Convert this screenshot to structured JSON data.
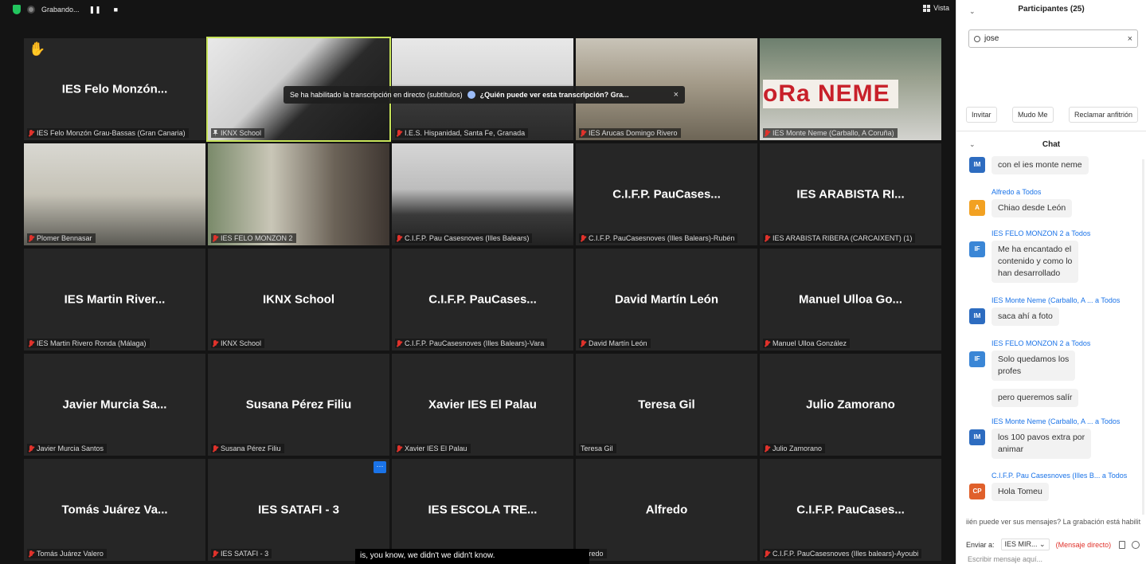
{
  "topbar": {
    "recording_label": "Grabando...",
    "pause_icon_text": "❚❚",
    "stop_icon_text": "■",
    "view_label": "Vista"
  },
  "transcription_banner": {
    "text": "Se ha habilitado la transcripción en directo (subtítulos)",
    "question": "¿Quién puede ver esta transcripción? Gra...",
    "close": "×"
  },
  "caption": "is, you know, we didn't we didn't know.",
  "more_button": "···",
  "tiles": [
    {
      "big": "IES Felo Monzón...",
      "label": "IES Felo Monzón Grau-Bassas (Gran Canaria)",
      "hand": true
    },
    {
      "big": "",
      "label": "IKNX School",
      "photo": "iknx-photo",
      "active": true,
      "pinned": true
    },
    {
      "big": "",
      "label": "I.E.S. Hispanidad, Santa Fe, Granada",
      "photo": "classroom-photo"
    },
    {
      "big": "",
      "label": "IES Arucas Domingo Rivero",
      "photo": "hall-photo"
    },
    {
      "big": "",
      "label": "IES Monte Neme (Carballo, A Coruña)",
      "photo": "neme-photo",
      "banner": "oRa NEME"
    },
    {
      "big": "",
      "label": "Plomer Bennasar",
      "photo": "lab-photo"
    },
    {
      "big": "",
      "label": "IES FELO MONZON 2",
      "photo": "couple-photo"
    },
    {
      "big": "",
      "label": "C.I.F.P. Pau Casesnoves (Illes Balears)",
      "photo": "headset-photo"
    },
    {
      "big": "C.I.F.P. PauCases...",
      "label": "C.I.F.P. PauCasesnoves (Illes Balears)-Rubén"
    },
    {
      "big": "IES ARABISTA RI...",
      "label": "IES ARABISTA RIBERA (CARCAIXENT) (1)"
    },
    {
      "big": "IES  Martin River...",
      "label": "IES  Martin Rivero Ronda (Málaga)"
    },
    {
      "big": "IKNX School",
      "label": "IKNX School"
    },
    {
      "big": "C.I.F.P. PauCases...",
      "label": "C.I.F.P. PauCasesnoves (Illes Balears)-Vara"
    },
    {
      "big": "David Martín León",
      "label": "David Martín León"
    },
    {
      "big": "Manuel Ulloa Go...",
      "label": "Manuel Ulloa González"
    },
    {
      "big": "Javier Murcia Sa...",
      "label": "Javier Murcia Santos"
    },
    {
      "big": "Susana Pérez Filiu",
      "label": "Susana Pérez Filiu"
    },
    {
      "big": "Xavier IES El Palau",
      "label": "Xavier IES El Palau"
    },
    {
      "big": "Teresa Gil",
      "label": "Teresa Gil",
      "nomic": true
    },
    {
      "big": "Julio Zamorano",
      "label": "Julio Zamorano"
    },
    {
      "big": "Tomás Juárez Va...",
      "label": "Tomás Juárez Valero"
    },
    {
      "big": "IES SATAFI - 3",
      "label": "IES SATAFI - 3"
    },
    {
      "big": "IES  ESCOLA TRE...",
      "label": ""
    },
    {
      "big": "Alfredo",
      "label": "Alfredo",
      "nomic": true
    },
    {
      "big": "C.I.F.P. PauCases...",
      "label": "C.I.F.P. PauCasesnoves (Illes balears)-Ayoubi"
    }
  ],
  "panel": {
    "participants_title": "Participantes (25)",
    "search_value": "jose",
    "buttons": [
      "Invitar",
      "Mudo Me",
      "Reclamar anfitrión"
    ],
    "chat_title": "Chat",
    "notice": "iién puede ver sus mensajes? La grabación está habilit",
    "send_to_label": "Enviar a:",
    "send_to_value": "IES MIR...",
    "direct_label": "(Mensaje directo)",
    "compose_placeholder": "Escribir mensaje aquí..."
  },
  "messages": [
    {
      "avatar": "IM",
      "color": "#2d6cc0",
      "sender": "",
      "lines": [
        "con el ies monte neme"
      ]
    },
    {
      "avatar": "A",
      "color": "#f2a122",
      "sender": "Alfredo a Todos",
      "lines": [
        "Chiao desde León"
      ]
    },
    {
      "avatar": "IF",
      "color": "#3a86d6",
      "sender": "IES FELO MONZON 2 a Todos",
      "lines": [
        "Me ha encantado el",
        "contenido y como lo",
        "han desarrollado"
      ]
    },
    {
      "avatar": "IM",
      "color": "#2d6cc0",
      "sender": "IES Monte Neme (Carballo, A ... a Todos",
      "lines": [
        "saca ahí a foto"
      ]
    },
    {
      "avatar": "IF",
      "color": "#3a86d6",
      "sender": "IES FELO MONZON 2 a Todos",
      "lines": [
        "Solo quedamos los",
        "profes"
      ]
    },
    {
      "avatar": "",
      "color": "",
      "sender": "",
      "lines": [
        "pero queremos salír"
      ]
    },
    {
      "avatar": "IM",
      "color": "#2d6cc0",
      "sender": "IES Monte Neme (Carballo, A ... a Todos",
      "lines": [
        "los 100 pavos extra por",
        "animar"
      ]
    },
    {
      "avatar": "CP",
      "color": "#e0602b",
      "sender": "C.I.F.P. Pau Casesnoves (Illes B... a Todos",
      "lines": [
        "Hola Tomeu"
      ]
    }
  ]
}
